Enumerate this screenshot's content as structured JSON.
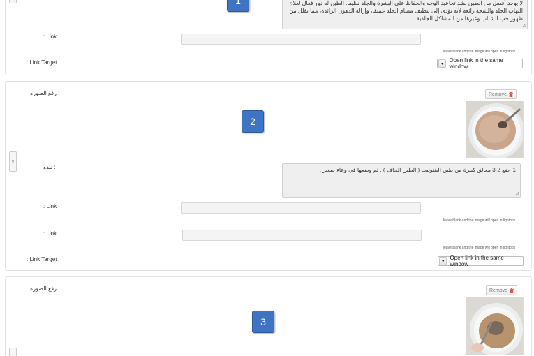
{
  "labels": {
    "link": ": Link",
    "link_target": ": Link Target",
    "upload_image": "رفع الصوره :",
    "brief": "نبذه :",
    "link_helper": "leave blank and the image will open in lightbox",
    "remove": "Remove",
    "open_same_window": "Open link in the same window"
  },
  "panel1": {
    "description_lines": [
      "لا يوجد أفضل من الطين لشد تجاعيد الوجه والحفاظ على البشرة والجلد نظيفا. الطين له دور فعال لعلاج",
      "التهاب الجلد والنتيجة رائعة لأنه يؤدى إلى تنظيف مسام الجلد عميقا، وإزالة الدهون الزائدة، مما يقلل من",
      "ظهور حب الشباب وغيرها من المشاكل الجلدية"
    ],
    "badge": "1"
  },
  "panel2": {
    "badge": "2",
    "description": "1: ضع 2-3 معالق كبيرة من طين البنتونيت ( الطين الجاف ) , ثم وضعها في وعاء صغير ."
  },
  "panel3": {
    "badge": "3"
  },
  "colors": {
    "badge": "#3f74c4",
    "trash": "#d9534f"
  }
}
